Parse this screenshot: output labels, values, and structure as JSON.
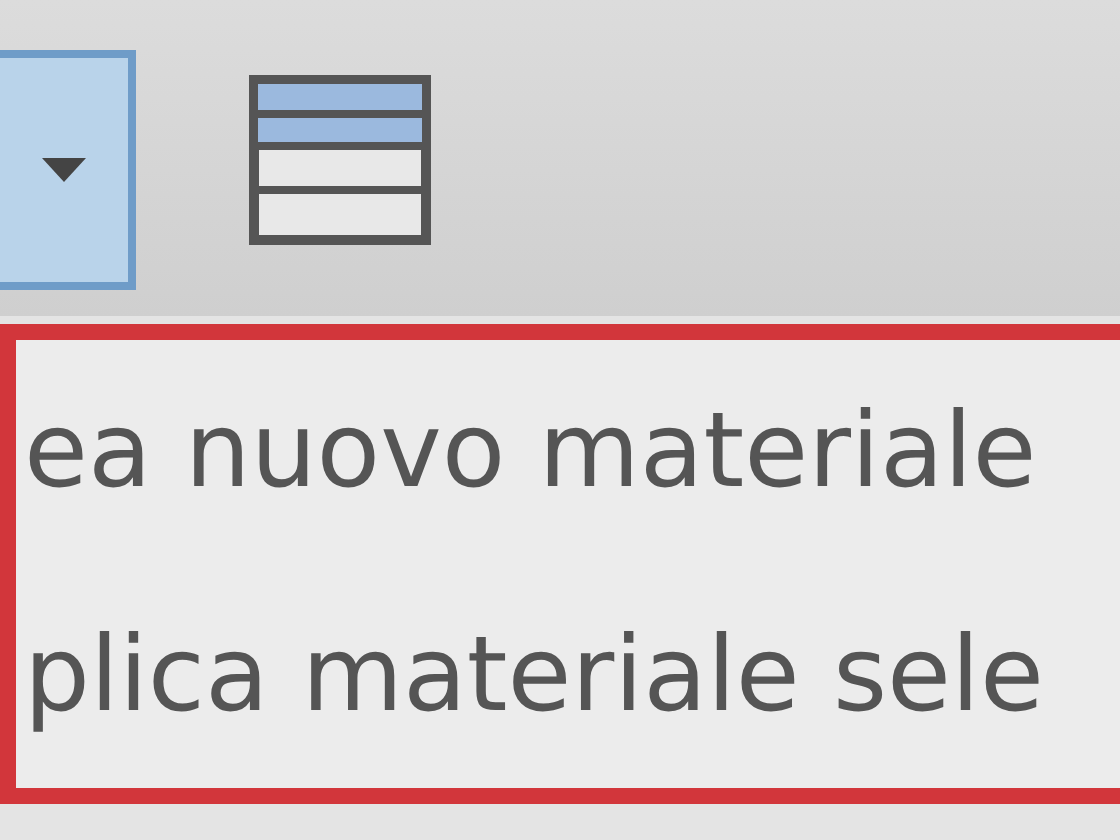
{
  "toolbar": {
    "buttons": [
      {
        "kind": "dropdown",
        "selected": true
      },
      {
        "kind": "table",
        "selected": false
      }
    ]
  },
  "menu": {
    "items": [
      {
        "label": "ea nuovo materiale"
      },
      {
        "label": "plica materiale sele"
      }
    ]
  }
}
